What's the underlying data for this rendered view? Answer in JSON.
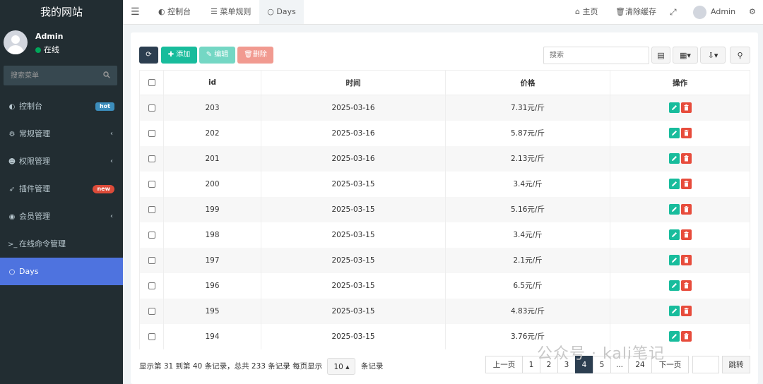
{
  "sidebar": {
    "brand": "我的网站",
    "user_name": "Admin",
    "user_status": "在线",
    "search_placeholder": "搜索菜单",
    "items": [
      {
        "label": "控制台",
        "icon": "dashboard-icon",
        "badge": "hot"
      },
      {
        "label": "常规管理",
        "icon": "cogs-icon",
        "has_children": true
      },
      {
        "label": "权限管理",
        "icon": "users-icon",
        "has_children": true
      },
      {
        "label": "插件管理",
        "icon": "rocket-icon",
        "badge": "new"
      },
      {
        "label": "会员管理",
        "icon": "user-circle-icon",
        "has_children": true
      },
      {
        "label": "在线命令管理",
        "icon": "terminal-icon"
      },
      {
        "label": "Days",
        "icon": "circle-icon",
        "active": true
      }
    ]
  },
  "topbar": {
    "tabs": [
      {
        "label": "控制台",
        "icon": "dashboard-icon"
      },
      {
        "label": "菜单规则",
        "icon": "list-icon"
      },
      {
        "label": "Days",
        "icon": "circle-icon",
        "active": true
      }
    ],
    "home_label": "主页",
    "clear_cache_label": "清除缓存",
    "user_name": "Admin"
  },
  "toolbar": {
    "refresh_icon": "refresh-icon",
    "add_label": "添加",
    "edit_label": "编辑",
    "delete_label": "删除",
    "search_placeholder": "搜索"
  },
  "table": {
    "columns": [
      "id",
      "时间",
      "价格",
      "操作"
    ],
    "rows": [
      {
        "id": "203",
        "time": "2025-03-16",
        "price": "7.31元/斤"
      },
      {
        "id": "202",
        "time": "2025-03-16",
        "price": "5.87元/斤"
      },
      {
        "id": "201",
        "time": "2025-03-16",
        "price": "2.13元/斤"
      },
      {
        "id": "200",
        "time": "2025-03-15",
        "price": "3.4元/斤"
      },
      {
        "id": "199",
        "time": "2025-03-15",
        "price": "5.16元/斤"
      },
      {
        "id": "198",
        "time": "2025-03-15",
        "price": "3.4元/斤"
      },
      {
        "id": "197",
        "time": "2025-03-15",
        "price": "2.1元/斤"
      },
      {
        "id": "196",
        "time": "2025-03-15",
        "price": "6.5元/斤"
      },
      {
        "id": "195",
        "time": "2025-03-15",
        "price": "4.83元/斤"
      },
      {
        "id": "194",
        "time": "2025-03-15",
        "price": "3.76元/斤"
      }
    ]
  },
  "footer": {
    "info_text": "显示第 31 到第 40 条记录，总共 233 条记录 每页显示",
    "page_size": "10",
    "records_suffix": "条记录"
  },
  "pagination": {
    "prev": "上一页",
    "pages": [
      "1",
      "2",
      "3",
      "4",
      "5",
      "...",
      "24"
    ],
    "current": "4",
    "next": "下一页",
    "jump": "跳转"
  },
  "watermark": "公众号 · kali笔记",
  "colors": {
    "sidebar_bg": "#222d32",
    "active_menu": "#4e73df",
    "success": "#18bc9c",
    "danger": "#e74c3c",
    "primary_dark": "#2c3e50"
  }
}
